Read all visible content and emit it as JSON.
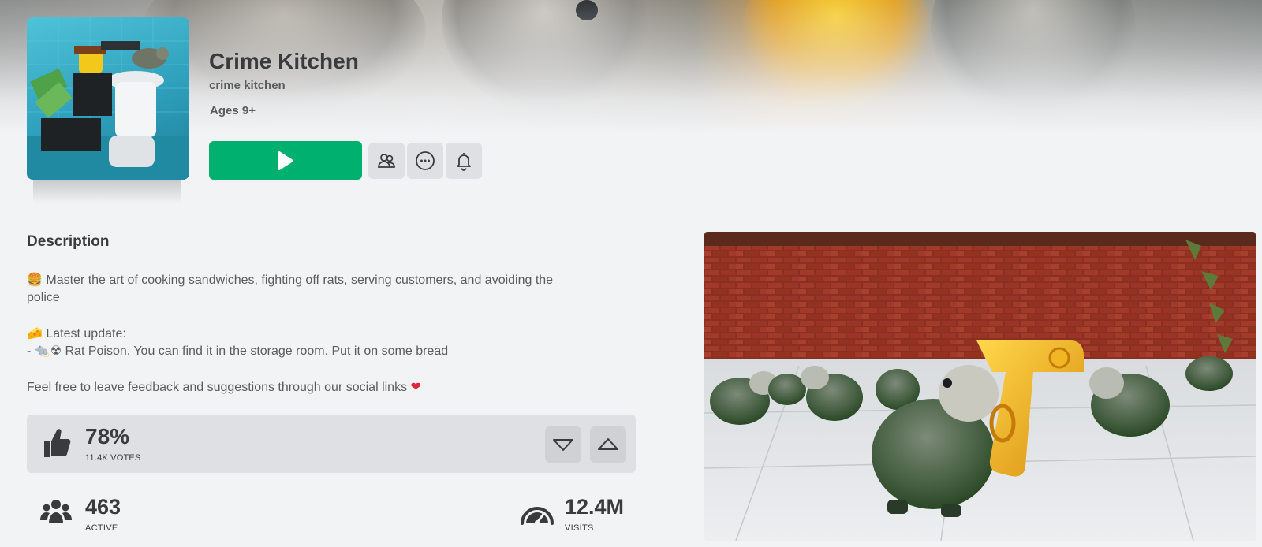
{
  "game": {
    "title": "Crime Kitchen",
    "creator": "crime kitchen",
    "ages": "Ages 9+"
  },
  "actions": {
    "play_icon": "play-icon",
    "friends_icon": "friends-icon",
    "more_icon": "more-icon",
    "notify_icon": "bell-icon"
  },
  "description": {
    "heading": "Description",
    "lines": [
      {
        "emoji": "🍔",
        "text": " Master the art of cooking sandwiches, fighting off rats, serving customers, and avoiding the"
      },
      {
        "emoji": "",
        "text": "police"
      },
      {
        "emoji": "🧀",
        "text": " Latest update:"
      },
      {
        "emoji": "",
        "text": "- 🐀☢ Rat Poison. You can find it in the storage room. Put it on some bread"
      },
      {
        "emoji": "",
        "text": "Feel free to leave feedback and suggestions through our social links"
      },
      {
        "emoji": "",
        "text": "❤"
      }
    ]
  },
  "votes": {
    "percent": "78%",
    "count": "11.4K VOTES",
    "upvote_ratio": 0.78
  },
  "stats": {
    "active_value": "463",
    "active_label": "ACTIVE",
    "visits_value": "12.4M",
    "visits_label": "VISITS"
  },
  "colors": {
    "play_green": "#00b06f",
    "button_gray": "#dfe0e3",
    "text_dark": "#393b3d",
    "heart_red": "#e0263a"
  }
}
